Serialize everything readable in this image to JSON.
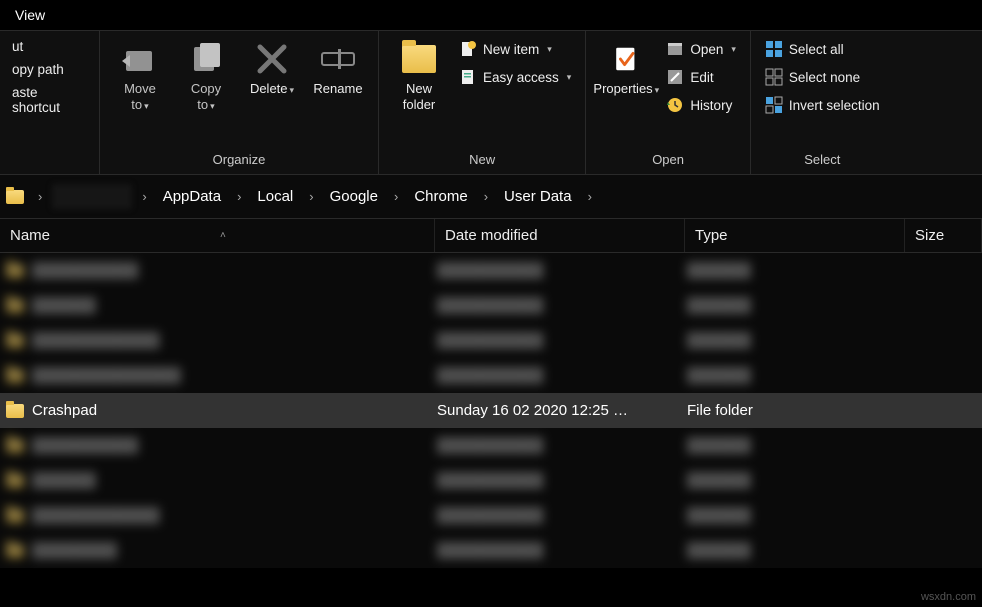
{
  "menubar": {
    "view": "View"
  },
  "ribbon": {
    "clipboard": {
      "cut": "ut",
      "copypath": "opy path",
      "paste_shortcut": "aste shortcut"
    },
    "organize": {
      "label": "Organize",
      "move_to": "Move\nto",
      "copy_to": "Copy\nto",
      "delete": "Delete",
      "rename": "Rename"
    },
    "new_group": {
      "label": "New",
      "new_folder": "New\nfolder",
      "new_item": "New item",
      "easy_access": "Easy access"
    },
    "open_group": {
      "label": "Open",
      "properties": "Properties",
      "open": "Open",
      "edit": "Edit",
      "history": "History"
    },
    "select_group": {
      "label": "Select",
      "select_all": "Select all",
      "select_none": "Select none",
      "invert": "Invert selection"
    }
  },
  "breadcrumb": [
    "AppData",
    "Local",
    "Google",
    "Chrome",
    "User Data"
  ],
  "columns": {
    "name": "Name",
    "date": "Date modified",
    "type": "Type",
    "size": "Size"
  },
  "rows": {
    "selected": {
      "name": "Crashpad",
      "date": "Sunday 16 02 2020 12:25 …",
      "type": "File folder"
    }
  },
  "watermark": "wsxdn.com"
}
